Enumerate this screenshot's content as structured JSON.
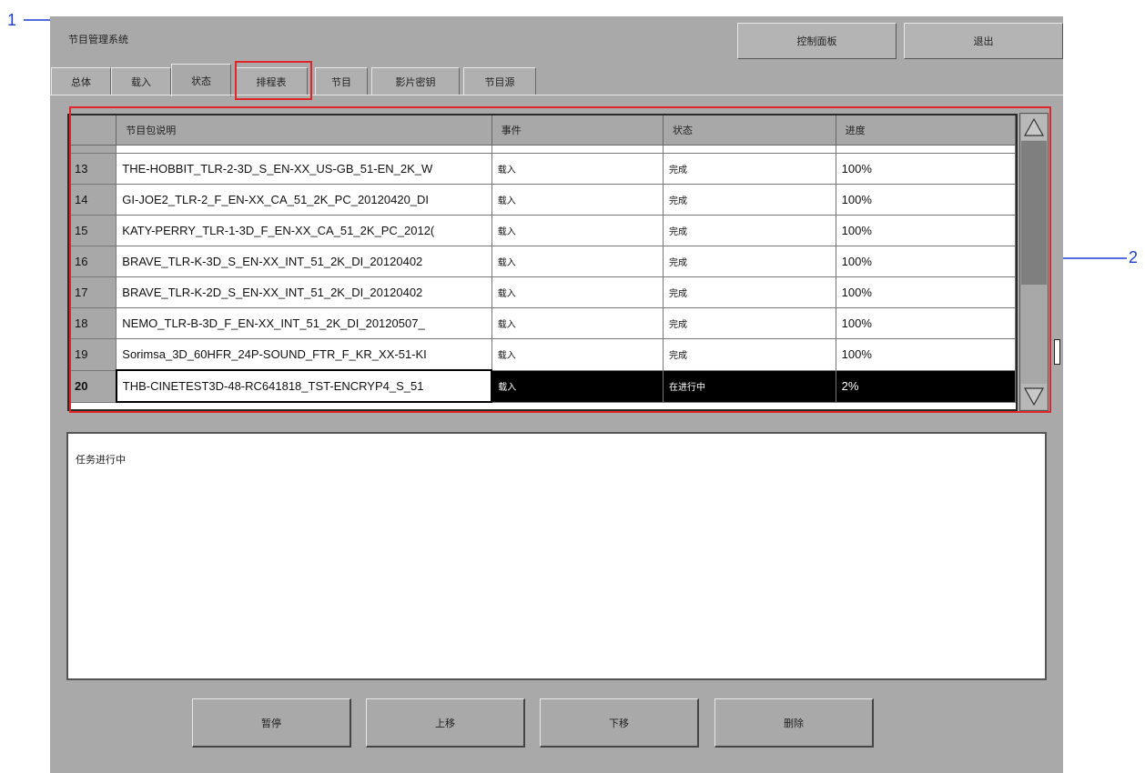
{
  "app_title": "节目管理系统",
  "top_buttons": {
    "control_panel": "控制面板",
    "exit": "退出"
  },
  "tabs": [
    {
      "label": "总体"
    },
    {
      "label": "载入"
    },
    {
      "label": "状态",
      "active": true
    },
    {
      "label": "排程表"
    },
    {
      "label": "节目"
    },
    {
      "label": "影片密钥"
    },
    {
      "label": "节目源"
    }
  ],
  "table": {
    "headers": [
      "",
      "节目包说明",
      "事件",
      "状态",
      "进度"
    ],
    "rows": [
      {
        "num": "13",
        "package": "THE-HOBBIT_TLR-2-3D_S_EN-XX_US-GB_51-EN_2K_W",
        "event": "载入",
        "status": "完成",
        "progress": "100%"
      },
      {
        "num": "14",
        "package": "GI-JOE2_TLR-2_F_EN-XX_CA_51_2K_PC_20120420_DI",
        "event": "载入",
        "status": "完成",
        "progress": "100%"
      },
      {
        "num": "15",
        "package": "KATY-PERRY_TLR-1-3D_F_EN-XX_CA_51_2K_PC_2012(",
        "event": "载入",
        "status": "完成",
        "progress": "100%"
      },
      {
        "num": "16",
        "package": "BRAVE_TLR-K-3D_S_EN-XX_INT_51_2K_DI_20120402",
        "event": "载入",
        "status": "完成",
        "progress": "100%"
      },
      {
        "num": "17",
        "package": "BRAVE_TLR-K-2D_S_EN-XX_INT_51_2K_DI_20120402",
        "event": "载入",
        "status": "完成",
        "progress": "100%"
      },
      {
        "num": "18",
        "package": "NEMO_TLR-B-3D_F_EN-XX_INT_51_2K_DI_20120507_",
        "event": "载入",
        "status": "完成",
        "progress": "100%"
      },
      {
        "num": "19",
        "package": "Sorimsa_3D_60HFR_24P-SOUND_FTR_F_KR_XX-51-KI",
        "event": "载入",
        "status": "完成",
        "progress": "100%"
      },
      {
        "num": "20",
        "package": "THB-CINETEST3D-48-RC641818_TST-ENCRYP4_S_51",
        "event": "载入",
        "status": "在进行中",
        "progress": "2%",
        "selected": true
      }
    ]
  },
  "log_text": "任务进行中",
  "bottom_buttons": {
    "pause": "暂停",
    "move_up": "上移",
    "move_down": "下移",
    "delete": "删除"
  },
  "callouts": {
    "one": "1",
    "two": "2"
  },
  "colors": {
    "highlight_box": "#e0262b",
    "callout_arrow": "#1a3fd0"
  }
}
